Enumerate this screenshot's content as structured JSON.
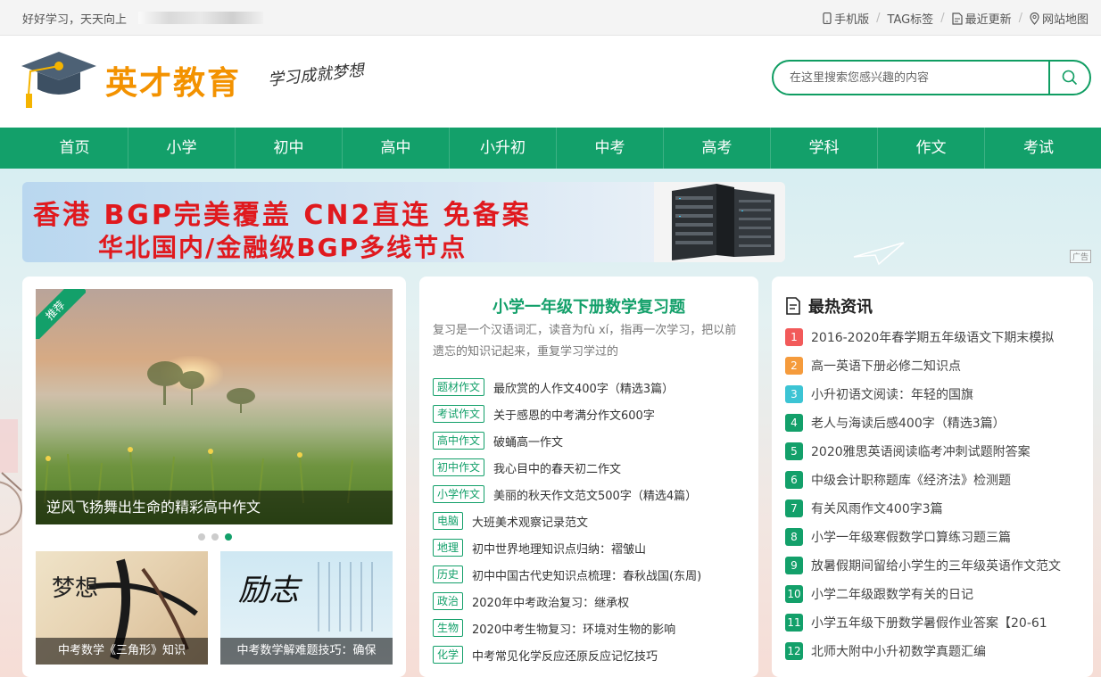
{
  "topbar": {
    "welcome": "好好学习，天天向上",
    "links": [
      "手机版",
      "TAG标签",
      "最近更新",
      "网站地图"
    ]
  },
  "header": {
    "logo_text": "英才教育",
    "slogan": "学习成就梦想",
    "search_placeholder": "在这里搜索您感兴趣的内容"
  },
  "nav": [
    "首页",
    "小学",
    "初中",
    "高中",
    "小升初",
    "中考",
    "高考",
    "学科",
    "作文",
    "考试"
  ],
  "ad": {
    "line1": "香港 BGP完美覆盖 CN2直连 免备案",
    "line2": "华北国内/金融级BGP多线节点",
    "tag": "广告"
  },
  "featured": {
    "badge": "推荐",
    "caption": "逆风飞扬舞出生命的精彩高中作文",
    "thumbs": [
      {
        "caption": "中考数学《三角形》知识"
      },
      {
        "caption": "中考数学解难题技巧：确保"
      }
    ],
    "thumb_art": {
      "t1": "梦想",
      "t2": "励志"
    }
  },
  "article": {
    "title": "小学一年级下册数学复习题",
    "desc": "复习是一个汉语词汇，读音为fù xí，指再一次学习，把以前遗忘的知识记起来，重复学习学过的",
    "items": [
      {
        "tag": "题材作文",
        "text": "最欣赏的人作文400字（精选3篇）"
      },
      {
        "tag": "考试作文",
        "text": "关于感恩的中考满分作文600字"
      },
      {
        "tag": "高中作文",
        "text": "破蛹高一作文"
      },
      {
        "tag": "初中作文",
        "text": "我心目中的春天初二作文"
      },
      {
        "tag": "小学作文",
        "text": "美丽的秋天作文范文500字（精选4篇）"
      },
      {
        "tag": "电脑",
        "text": "大班美术观察记录范文"
      },
      {
        "tag": "地理",
        "text": "初中世界地理知识点归纳：褶皱山"
      },
      {
        "tag": "历史",
        "text": "初中中国古代史知识点梳理：春秋战国(东周)"
      },
      {
        "tag": "政治",
        "text": "2020年中考政治复习：继承权"
      },
      {
        "tag": "生物",
        "text": "2020中考生物复习：环境对生物的影响"
      },
      {
        "tag": "化学",
        "text": "中考常见化学反应还原反应记忆技巧"
      }
    ]
  },
  "hot": {
    "title": "最热资讯",
    "colors": {
      "1": "#f25a5a",
      "2": "#f59b3c",
      "3": "#3cc4d4",
      "rest": "#13a06a"
    },
    "items": [
      {
        "num": "1",
        "text": "2016-2020年春学期五年级语文下期末模拟"
      },
      {
        "num": "2",
        "text": "高一英语下册必修二知识点"
      },
      {
        "num": "3",
        "text": "小升初语文阅读：年轻的国旗"
      },
      {
        "num": "4",
        "text": "老人与海读后感400字（精选3篇）"
      },
      {
        "num": "5",
        "text": "2020雅思英语阅读临考冲刺试题附答案"
      },
      {
        "num": "6",
        "text": "中级会计职称题库《经济法》检测题"
      },
      {
        "num": "7",
        "text": "有关风雨作文400字3篇"
      },
      {
        "num": "8",
        "text": "小学一年级寒假数学口算练习题三篇"
      },
      {
        "num": "9",
        "text": "放暑假期间留给小学生的三年级英语作文范文"
      },
      {
        "num": "10",
        "text": "小学二年级跟数学有关的日记"
      },
      {
        "num": "11",
        "text": "小学五年级下册数学暑假作业答案【20-61"
      },
      {
        "num": "12",
        "text": "北师大附中小升初数学真题汇编"
      }
    ]
  }
}
